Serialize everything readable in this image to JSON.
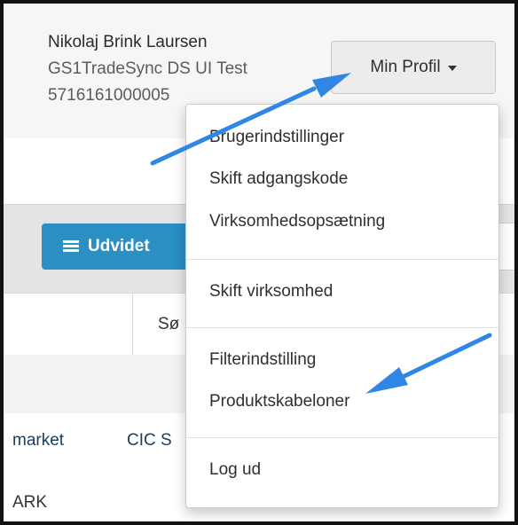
{
  "header": {
    "user_name": "Nikolaj Brink Laursen",
    "organization": "GS1TradeSync DS UI Test",
    "gln": "5716161000005",
    "profile_button_label": "Min Profil"
  },
  "profile_menu": {
    "items": [
      {
        "label": "Brugerindstillinger"
      },
      {
        "label": "Skift adgangskode"
      },
      {
        "label": "Virksomhedsopsætning"
      },
      {
        "label": "Skift virksomhed"
      },
      {
        "label": "Filterindstilling"
      },
      {
        "label": "Produktskabeloner"
      },
      {
        "label": "Log ud"
      }
    ]
  },
  "toolbar": {
    "advanced_button_label": "Udvidet",
    "advanced_icon": "list-icon"
  },
  "search": {
    "button_label_partial": "Sø"
  },
  "tabs": {
    "market_label": "market",
    "cic_label": "CIC S"
  },
  "bottom": {
    "text": "ARK"
  },
  "colors": {
    "primary_button": "#2a8fc3",
    "annotation_arrow": "#2f86e4",
    "frame_border": "#111111"
  }
}
